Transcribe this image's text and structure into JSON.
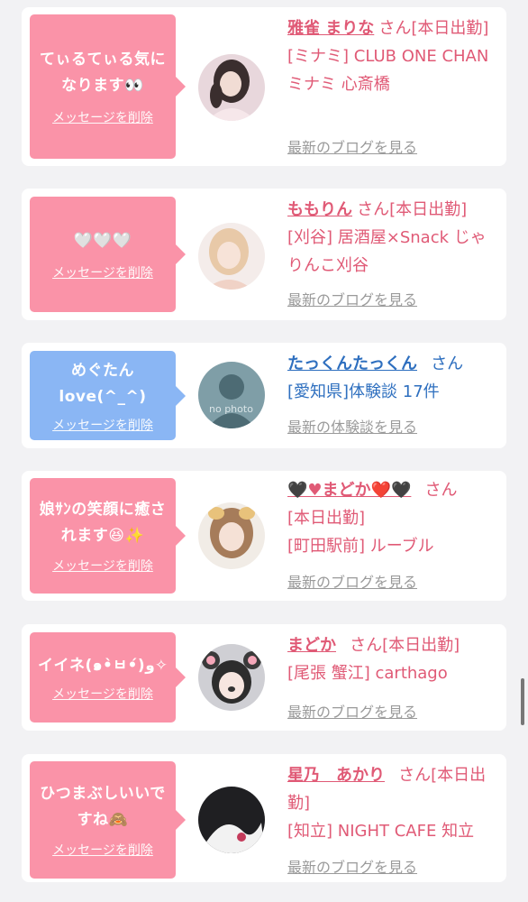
{
  "cards": [
    {
      "message": "てぃるてぃる気になります👀",
      "delete_label": "メッセージを削除",
      "name": "雅雀 まりな",
      "san": "さん",
      "status": "[本日出勤]",
      "shop": "[ミナミ] CLUB ONE CHAN ミナミ 心斎橋",
      "link": "最新のブログを見る"
    },
    {
      "message": "🤍🤍🤍",
      "delete_label": "メッセージを削除",
      "name": "ももりん",
      "san": "さん",
      "status": "[本日出勤]",
      "shop": "[刈谷] 居酒屋×Snack じゃりんこ刈谷",
      "link": "最新のブログを見る"
    },
    {
      "message": "めぐたん love(^_^)",
      "delete_label": "メッセージを削除",
      "name": "たっくんたっくん",
      "san": "さん",
      "status": "",
      "shop": "[愛知県]体験談 17件",
      "link": "最新の体験談を見る",
      "avatar_text": "no photo"
    },
    {
      "message": "娘ｻﾝの笑顔に癒されます😆✨",
      "delete_label": "メッセージを削除",
      "name": "🖤♥まどか❤️🖤",
      "san": "さん",
      "status": "[本日出勤]",
      "shop": "[町田駅前] ルーブル",
      "link": "最新のブログを見る"
    },
    {
      "message": "イイネ(๑•̀ㅂ•́)و✧",
      "delete_label": "メッセージを削除",
      "name": "まどか",
      "san": "さん",
      "status": "[本日出勤]",
      "shop": "[尾張 蟹江] carthago",
      "link": "最新のブログを見る"
    },
    {
      "message": "ひつまぶしいいですね🙈",
      "delete_label": "メッセージを削除",
      "name": "星乃　あかり",
      "san": "さん",
      "status": "[本日出勤]",
      "shop": "[知立] NIGHT CAFE 知立",
      "link": "最新のブログを見る"
    }
  ],
  "colors": {
    "pink_bubble": "#fa93a8",
    "blue_bubble": "#8ab6f4",
    "pink_text": "#e05a76",
    "blue_text": "#2e6fbf",
    "link_gray": "#9a9a9a"
  }
}
